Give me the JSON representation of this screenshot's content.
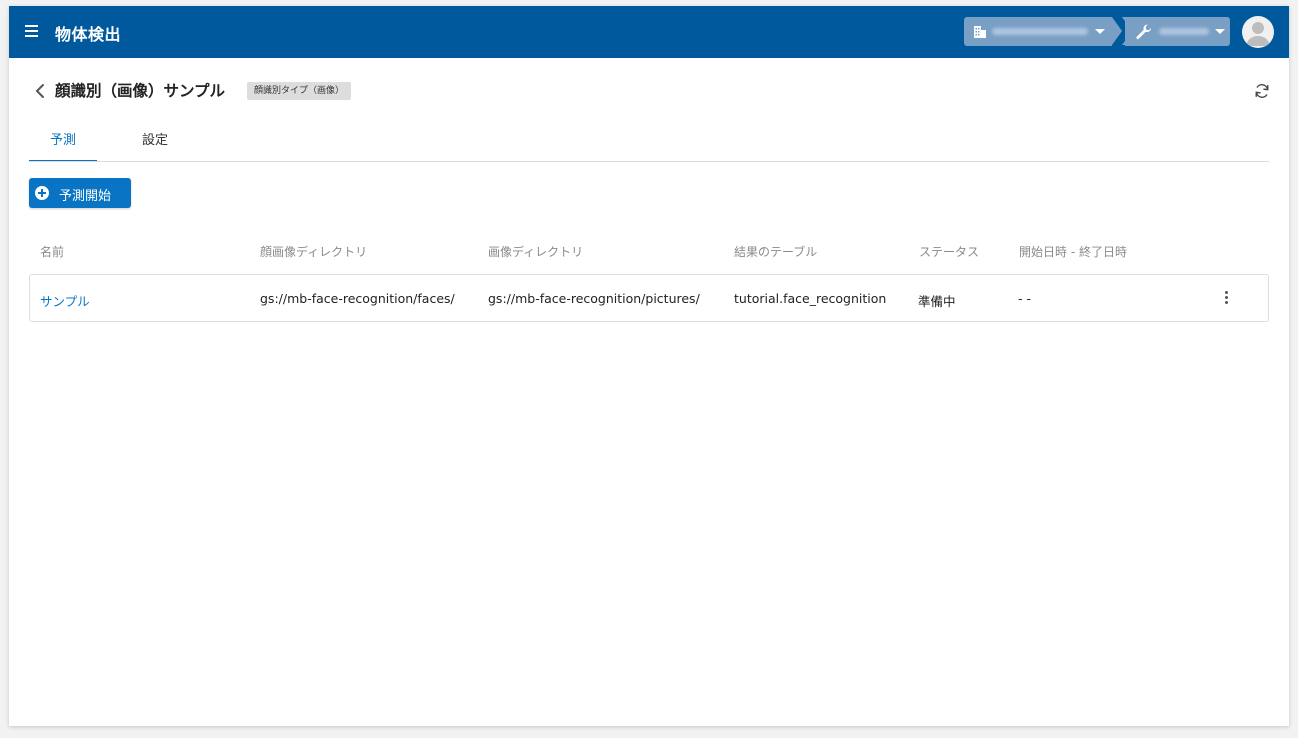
{
  "appbar": {
    "title": "物体検出",
    "menu_icon": "hamburger-icon",
    "org_icon": "building-icon",
    "project_icon": "wrench-icon",
    "bg_color": "#00599c"
  },
  "header": {
    "title": "顔識別（画像）サンプル",
    "type_badge": "顔識別タイプ（画像）"
  },
  "tabs": [
    {
      "label": "予測",
      "active": true
    },
    {
      "label": "設定",
      "active": false
    }
  ],
  "actions": {
    "start_label": "予測開始"
  },
  "table": {
    "columns": [
      "名前",
      "顔画像ディレクトリ",
      "画像ディレクトリ",
      "結果のテーブル",
      "ステータス",
      "開始日時 - 終了日時"
    ],
    "rows": [
      {
        "name": "サンプル",
        "face_dir": "gs://mb-face-recognition/faces/",
        "image_dir": "gs://mb-face-recognition/pictures/",
        "result_table": "tutorial.face_recognition",
        "status": "準備中",
        "period": "- -"
      }
    ]
  },
  "colors": {
    "accent": "#0a74c4",
    "breadcrumb": "#7a9fc5"
  }
}
